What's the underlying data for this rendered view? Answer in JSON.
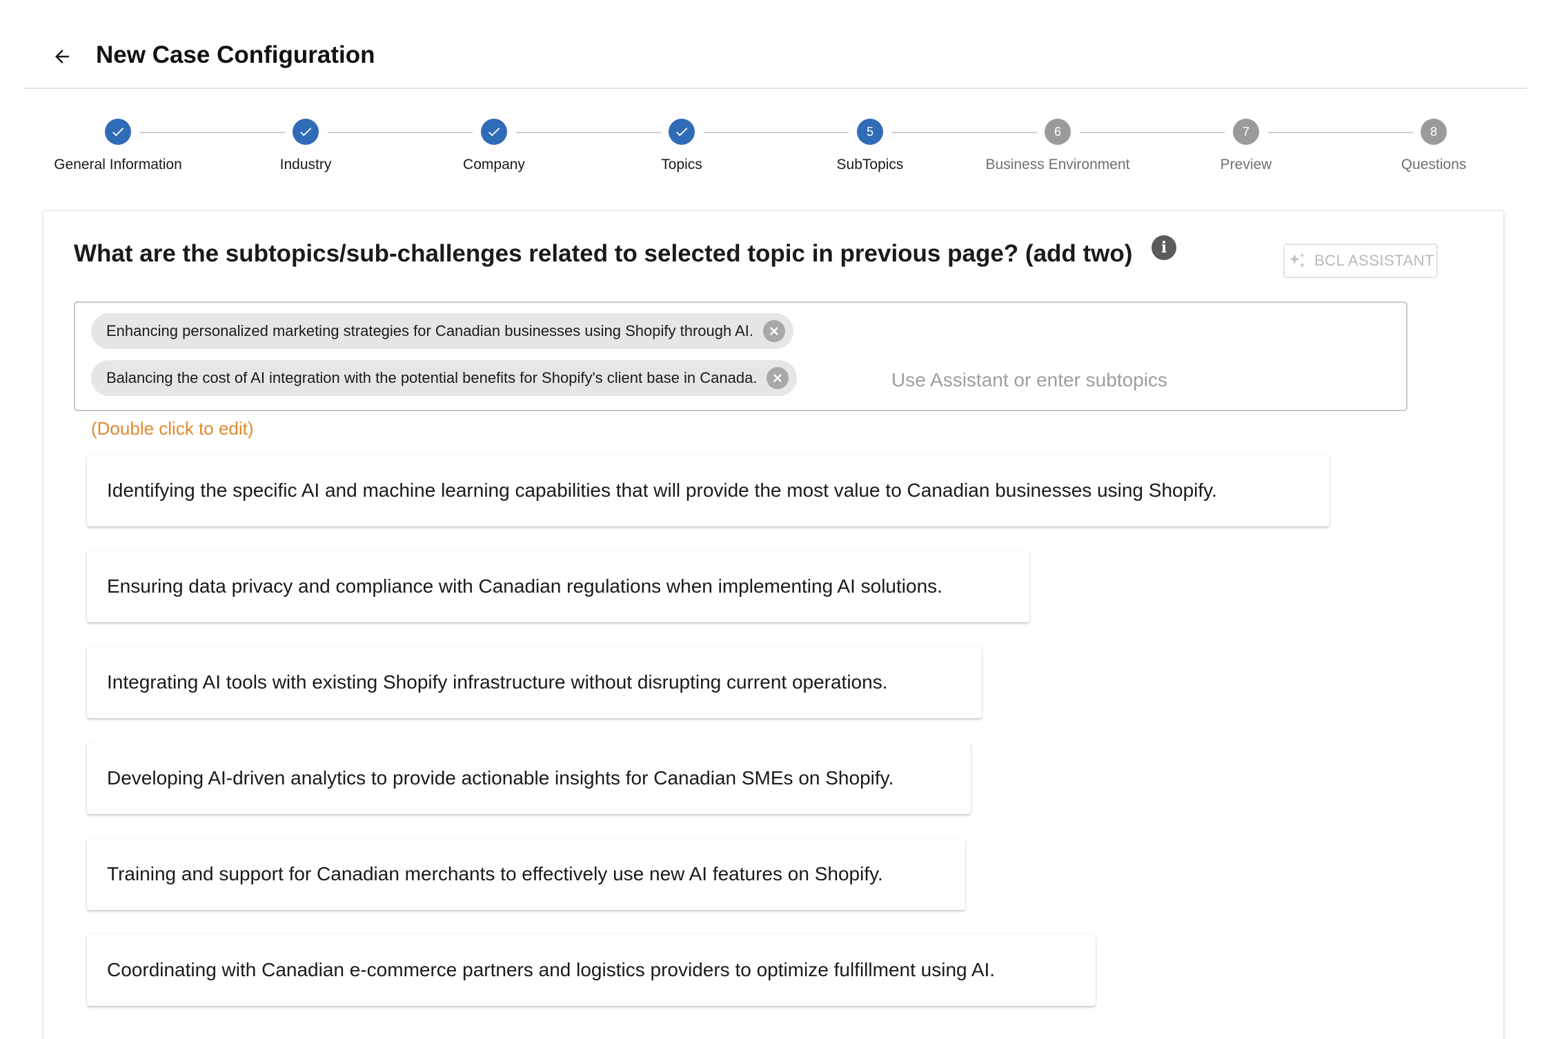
{
  "header": {
    "title": "New Case Configuration",
    "back_icon": "arrow-left-icon"
  },
  "stepper": {
    "steps": [
      {
        "number": "1",
        "label": "General Information",
        "state": "completed"
      },
      {
        "number": "2",
        "label": "Industry",
        "state": "completed"
      },
      {
        "number": "3",
        "label": "Company",
        "state": "completed"
      },
      {
        "number": "4",
        "label": "Topics",
        "state": "completed"
      },
      {
        "number": "5",
        "label": "SubTopics",
        "state": "active"
      },
      {
        "number": "6",
        "label": "Business Environment",
        "state": "pending"
      },
      {
        "number": "7",
        "label": "Preview",
        "state": "pending"
      },
      {
        "number": "8",
        "label": "Questions",
        "state": "pending"
      }
    ],
    "colors": {
      "completed": "#2f6bb7",
      "pending": "#9a9a9a"
    }
  },
  "form": {
    "question": "What are the subtopics/sub-challenges related to selected topic in previous page? (add two)",
    "info_icon": "info-icon",
    "assistant_button": {
      "label": "BCL ASSISTANT",
      "icon": "sparkle-icon",
      "disabled": true
    },
    "chips": [
      "Enhancing personalized marketing strategies for Canadian businesses using Shopify through AI.",
      "Balancing the cost of AI integration with the potential benefits for Shopify's client base in Canada."
    ],
    "input": {
      "value": "",
      "placeholder": "Use Assistant or enter subtopics"
    },
    "hint": "(Double click to edit)",
    "hint_color": "#e08a2c"
  },
  "suggestions": [
    "Identifying the specific AI and machine learning capabilities that will provide the most value to Canadian businesses using Shopify.",
    "Ensuring data privacy and compliance with Canadian regulations when implementing AI solutions.",
    "Integrating AI tools with existing Shopify infrastructure without disrupting current operations.",
    "Developing AI-driven analytics to provide actionable insights for Canadian SMEs on Shopify.",
    "Training and support for Canadian merchants to effectively use new AI features on Shopify.",
    "Coordinating with Canadian e-commerce partners and logistics providers to optimize fulfillment using AI."
  ]
}
